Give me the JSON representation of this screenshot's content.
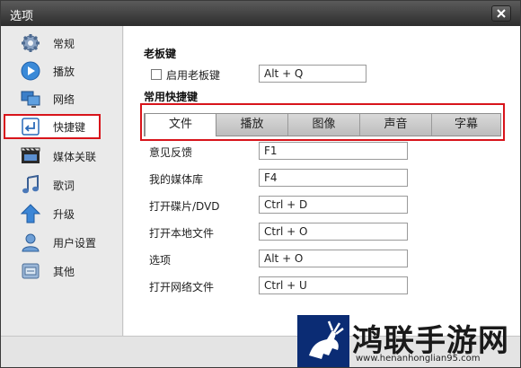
{
  "window": {
    "title": "选项"
  },
  "sidebar": {
    "items": [
      {
        "label": "常规",
        "icon": "gear-icon"
      },
      {
        "label": "播放",
        "icon": "play-icon"
      },
      {
        "label": "网络",
        "icon": "network-icon"
      },
      {
        "label": "快捷键",
        "icon": "enter-key-icon",
        "active": true
      },
      {
        "label": "媒体关联",
        "icon": "film-icon"
      },
      {
        "label": "歌词",
        "icon": "music-note-icon"
      },
      {
        "label": "升级",
        "icon": "up-arrow-icon"
      },
      {
        "label": "用户设置",
        "icon": "user-icon"
      },
      {
        "label": "其他",
        "icon": "other-icon"
      }
    ]
  },
  "boss_key": {
    "section_title": "老板键",
    "checkbox_label": "启用老板键",
    "checked": false,
    "value": "Alt + Q"
  },
  "shortcuts": {
    "section_title": "常用快捷键",
    "tabs": [
      "文件",
      "播放",
      "图像",
      "声音",
      "字幕"
    ],
    "active_tab": "文件",
    "rows": [
      {
        "label": "意见反馈",
        "value": "F1"
      },
      {
        "label": "我的媒体库",
        "value": "F4"
      },
      {
        "label": "打开碟片/DVD",
        "value": "Ctrl + D"
      },
      {
        "label": "打开本地文件",
        "value": "Ctrl + O"
      },
      {
        "label": "选项",
        "value": "Alt + O"
      },
      {
        "label": "打开网络文件",
        "value": "Ctrl + U"
      }
    ]
  },
  "watermark": {
    "text": "鸿联手游网",
    "url": "www.henanhonglian95.com"
  },
  "colors": {
    "highlight_red": "#d8141b",
    "title_bar": "#3c3c3c"
  }
}
